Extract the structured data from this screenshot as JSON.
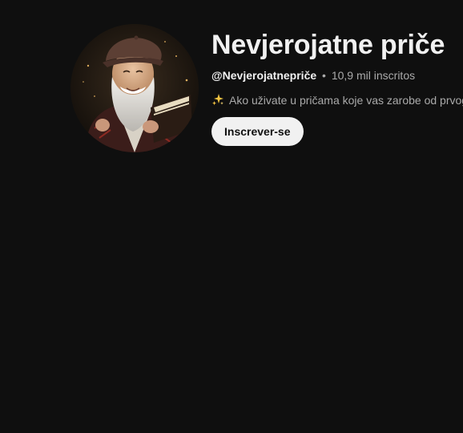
{
  "channel": {
    "title": "Nevjerojatne priče",
    "handle": "@Nevjerojatnepriče",
    "separator": "•",
    "subscribers": "10,9 mil inscritos",
    "description": "Ako uživate u pričama koje vas zarobe od prvog",
    "description_icon": "sparkles-icon",
    "avatar_description": "avatar-image"
  },
  "actions": {
    "subscribe_label": "Inscrever-se"
  },
  "colors": {
    "background": "#0f0f0f",
    "text_primary": "#f1f1f1",
    "text_secondary": "#aaaaaa",
    "button_bg": "#f1f1f1",
    "button_text": "#0f0f0f"
  }
}
